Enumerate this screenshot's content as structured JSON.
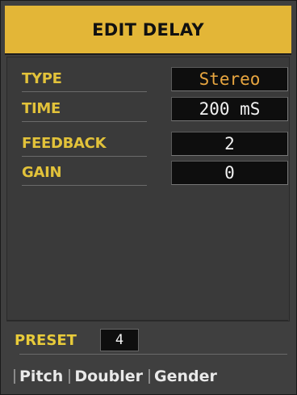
{
  "header": {
    "title": "EDIT DELAY"
  },
  "params": [
    {
      "label": "TYPE",
      "value": "Stereo"
    },
    {
      "label": "TIME",
      "value": "200 mS"
    },
    {
      "label": "FEEDBACK",
      "value": "2"
    },
    {
      "label": "GAIN",
      "value": "0"
    }
  ],
  "preset": {
    "label": "PRESET",
    "value": "4"
  },
  "softkeys": [
    "Pitch",
    "Doubler",
    "Gender"
  ],
  "colors": {
    "header_bg": "#e3b637",
    "label_color": "#e2c23a",
    "value_accent": "#e8a640",
    "panel_bg": "#3f3f3f"
  }
}
